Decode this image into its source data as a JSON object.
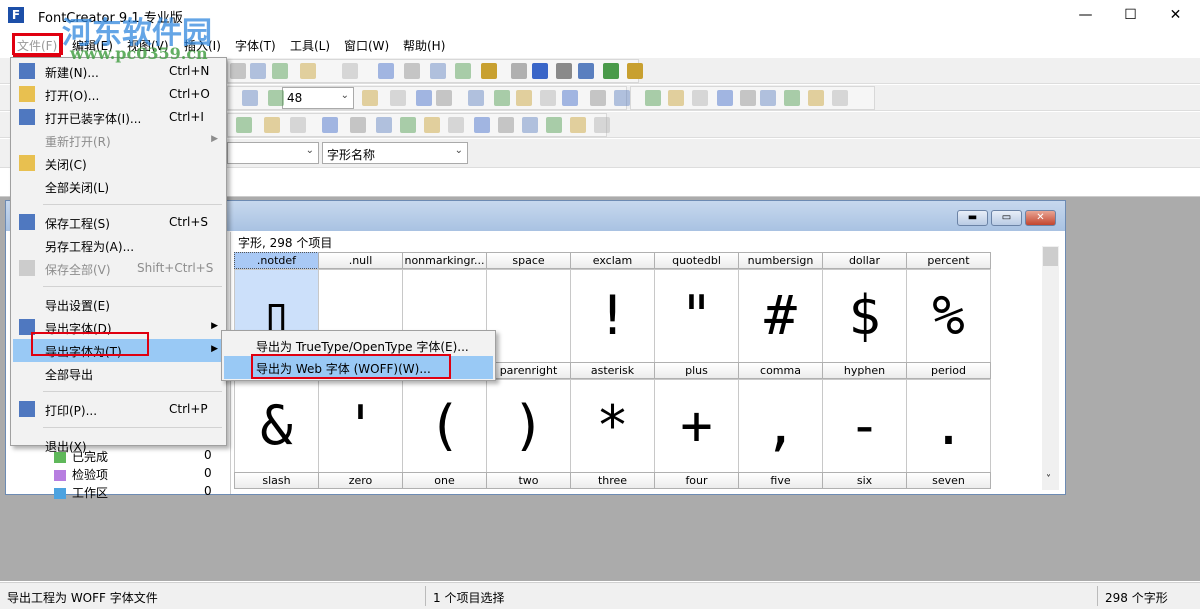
{
  "window": {
    "title": "FontCreator 9.1 专业版",
    "minimize": "—",
    "maximize": "☐",
    "close": "✕"
  },
  "watermark": {
    "name": "河东软件园",
    "url": "www.pc0359.cn"
  },
  "menubar": [
    "文件(F)",
    "编辑(E)",
    "视图(V)",
    "插入(I)",
    "字体(T)",
    "工具(L)",
    "窗口(W)",
    "帮助(H)"
  ],
  "toolbar": {
    "zoom_value": "48",
    "glyph_name_combo": "字形名称"
  },
  "file_menu": [
    {
      "label": "新建(N)...",
      "shortcut": "Ctrl+N",
      "icon": "new-file-icon"
    },
    {
      "label": "打开(O)...",
      "shortcut": "Ctrl+O",
      "icon": "folder-open-icon"
    },
    {
      "label": "打开已装字体(I)...",
      "shortcut": "Ctrl+I",
      "icon": "installed-font-icon"
    },
    {
      "label": "重新打开(R)",
      "disabled": true,
      "submenu": true
    },
    {
      "label": "关闭(C)",
      "icon": "folder-close-icon"
    },
    {
      "label": "全部关闭(L)"
    },
    {
      "separator": true
    },
    {
      "label": "保存工程(S)",
      "shortcut": "Ctrl+S",
      "icon": "save-icon"
    },
    {
      "label": "另存工程为(A)..."
    },
    {
      "label": "保存全部(V)",
      "shortcut": "Shift+Ctrl+S",
      "disabled": true,
      "icon": "save-all-icon"
    },
    {
      "separator": true
    },
    {
      "label": "导出设置(E)"
    },
    {
      "label": "导出字体(D)",
      "submenu": true,
      "icon": "export-font-icon"
    },
    {
      "label": "导出字体为(T)...",
      "submenu": true,
      "highlighted": true
    },
    {
      "label": "全部导出"
    },
    {
      "separator": true
    },
    {
      "label": "打印(P)...",
      "shortcut": "Ctrl+P",
      "icon": "printer-icon"
    },
    {
      "separator": true
    },
    {
      "label": "退出(X)"
    }
  ],
  "export_submenu": [
    "导出为 TrueType/OpenType 字体(E)...",
    "导出为 Web 字体 (WOFF)(W)..."
  ],
  "font_window": {
    "count_label": "字形, 298 个项目",
    "tree": [
      {
        "label": "已完成",
        "count": "0",
        "color": "#5fb85a"
      },
      {
        "label": "检验项",
        "count": "0",
        "color": "#b77ee0"
      },
      {
        "label": "工作区",
        "count": "0",
        "color": "#4da3e0"
      }
    ],
    "rows": [
      {
        "names": [
          ".notdef",
          ".null",
          "nonmarkingr...",
          "space",
          "exclam",
          "quotedbl",
          "numbersign",
          "dollar",
          "percent"
        ],
        "glyphs": [
          "▯",
          "",
          "",
          "",
          "!",
          "\"",
          "#",
          "$",
          "%"
        ]
      },
      {
        "names": [
          "",
          "",
          "",
          "parenright",
          "asterisk",
          "plus",
          "comma",
          "hyphen",
          "period"
        ],
        "glyphs": [
          "&",
          "'",
          "(",
          ")",
          "*",
          "+",
          ",",
          "-",
          "."
        ]
      },
      {
        "names": [
          "slash",
          "zero",
          "one",
          "two",
          "three",
          "four",
          "five",
          "six",
          "seven"
        ],
        "glyphs": []
      }
    ]
  },
  "statusbar": {
    "message": "导出工程为 WOFF 字体文件",
    "selection": "1 个项目选择",
    "glyph_count": "298 个字形"
  }
}
